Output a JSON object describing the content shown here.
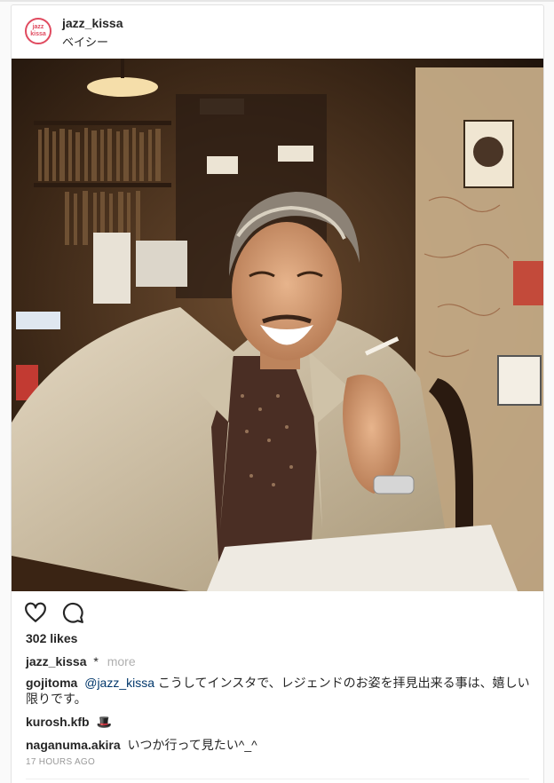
{
  "post": {
    "username": "jazz_kissa",
    "location": "ベイシー",
    "avatar_text": [
      "jazz",
      "kissa"
    ],
    "likes": "302 likes",
    "caption_user": "jazz_kissa",
    "caption_text": "*",
    "more_label": "more",
    "comments": [
      {
        "user": "gojitoma",
        "mention": "@jazz_kissa",
        "text": "こうしてインスタで、レジェンドのお姿を拝見出来る事は、嬉しい限りです。"
      },
      {
        "user": "kurosh.kfb",
        "mention": "",
        "text": "🎩"
      },
      {
        "user": "naganuma.akira",
        "mention": "",
        "text": "いつか行って見たい^_^"
      }
    ],
    "timestamp": "17 HOURS AGO"
  },
  "icons": {
    "like": "heart-icon",
    "comment": "comment-bubble-icon"
  },
  "colors": {
    "avatar_ring": "#e04a5f",
    "link": "#00376b",
    "muted": "#999999"
  }
}
